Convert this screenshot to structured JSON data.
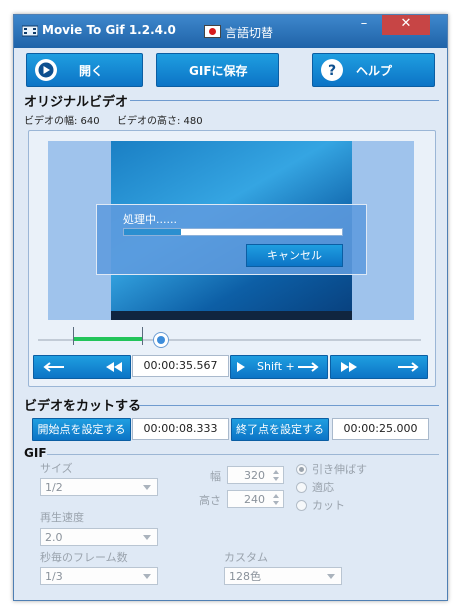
{
  "window": {
    "title": "Movie To Gif 1.2.4.0",
    "language_label": "言語切替",
    "minimize": "–",
    "close": "✕"
  },
  "toolbar": {
    "open_label": "開く",
    "save_gif_label": "GIFに保存",
    "help_label": "ヘルプ"
  },
  "original_video": {
    "section_title": "オリジナルビデオ",
    "width_label": "ビデオの幅: 640",
    "height_label": "ビデオの高さ: 480"
  },
  "processing_dialog": {
    "text": "処理中......",
    "progress": 0.26,
    "cancel_label": "キャンセル"
  },
  "playback": {
    "current_time": "00:00:35.567",
    "shift_forward_label": "Shift +",
    "back_icon": "arrow-left-icon",
    "rewind_icon": "double-rewind-icon",
    "play_icon": "play-icon",
    "fast_forward_icon": "double-forward-icon",
    "forward_icon": "arrow-right-icon"
  },
  "cut": {
    "section_title": "ビデオをカットする",
    "set_start_label": "開始点を設定する",
    "start_time": "00:00:08.333",
    "set_end_label": "終了点を設定する",
    "end_time": "00:00:25.000"
  },
  "gif": {
    "section_title": "GIF",
    "size_label": "サイズ",
    "size_value": "1/2",
    "width_label": "幅",
    "width_value": "320",
    "height_label": "高さ",
    "height_value": "240",
    "radio_stretch": "引き伸ばす",
    "radio_fit": "適応",
    "radio_cut": "カット",
    "speed_label": "再生速度",
    "speed_value": "2.0",
    "fps_label": "秒毎のフレーム数",
    "fps_value": "1/3",
    "custom_label": "カスタム",
    "custom_value": "128色"
  },
  "colors": {
    "accent": "#0c74c6",
    "titlebar": "#1f63a8",
    "close": "#c74545",
    "range": "#22c45a"
  }
}
